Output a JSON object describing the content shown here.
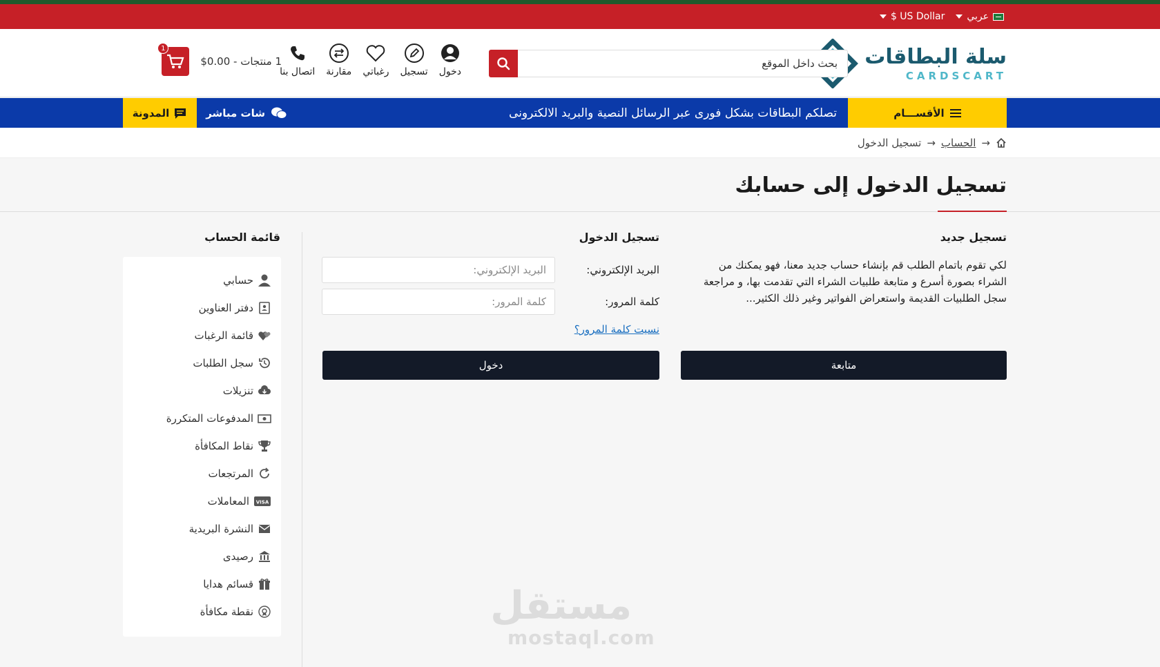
{
  "topbar": {
    "language": "عربي",
    "currency": "US Dollar $"
  },
  "header": {
    "logo_ar": "سلة البطاقات",
    "logo_en": "CARDSCART",
    "search_placeholder": "بحث داخل الموقع",
    "icons": [
      {
        "label": "دخول",
        "icon": "user-icon"
      },
      {
        "label": "تسجيل",
        "icon": "pencil-icon"
      },
      {
        "label": "رغباتي",
        "icon": "heart-icon"
      },
      {
        "label": "مقارنة",
        "icon": "compare-icon"
      },
      {
        "label": "اتصال بنا",
        "icon": "phone-icon"
      }
    ],
    "cart_text": "1 منتجات - 0.00$",
    "cart_count": "1"
  },
  "nav": {
    "categories": "الأقســـام",
    "marquee": "تصلكم البطاقات بشكل فورى عبر الرسائل النصية والبريد الالكترونى",
    "chat": "شات مباشر",
    "blog": "المدونة"
  },
  "breadcrumb": {
    "account": "الحساب",
    "separator": "→",
    "current": "تسجيل الدخول"
  },
  "page": {
    "title": "تسجيل الدخول إلى حسابك"
  },
  "new_customer": {
    "heading": "تسجيل جديد",
    "description": "لكي تقوم باتمام الطلب قم بإنشاء حساب جديد معنا، فهو يمكنك من الشراء بصورة أسرع و متابعة طلبيات الشراء التي تقدمت بها، و مراجعة سجل الطلبيات القديمة واستعراض الفواتير وغير ذلك الكثير...",
    "button": "متابعة"
  },
  "login": {
    "heading": "تسجيل الدخول",
    "email_label": "البريد الإلكتروني:",
    "email_placeholder": "البريد الإلكتروني:",
    "password_label": "كلمة المرور:",
    "password_placeholder": "كلمة المرور:",
    "forgot": "نسيت كلمة المرور؟",
    "button": "دخول"
  },
  "account_menu": {
    "heading": "قائمة الحساب",
    "items": [
      {
        "label": "حسابي",
        "icon": "user-icon"
      },
      {
        "label": "دفتر العناوين",
        "icon": "address-book-icon"
      },
      {
        "label": "قائمة الرغبات",
        "icon": "hearts-icon"
      },
      {
        "label": "سجل الطلبات",
        "icon": "history-icon"
      },
      {
        "label": "تنزيلات",
        "icon": "cloud-download-icon"
      },
      {
        "label": "المدفوعات المتكررة",
        "icon": "money-icon"
      },
      {
        "label": "نقاط المكافأة",
        "icon": "trophy-icon"
      },
      {
        "label": "المرتجعات",
        "icon": "refresh-icon"
      },
      {
        "label": "المعاملات",
        "icon": "visa-card-icon"
      },
      {
        "label": "النشرة البريدية",
        "icon": "envelope-icon"
      },
      {
        "label": "رصيدى",
        "icon": "bank-icon"
      },
      {
        "label": "قسائم هدايا",
        "icon": "gift-icon"
      },
      {
        "label": "نقطة مكافأة",
        "icon": "award-icon"
      }
    ]
  },
  "watermark": {
    "ar": "مستقل",
    "en": "mostaql.com"
  },
  "colors": {
    "red": "#c62027",
    "blue": "#0b3aa9",
    "yellow": "#ffcc00",
    "dark": "#131a28",
    "teal": "#1b5a6e"
  }
}
